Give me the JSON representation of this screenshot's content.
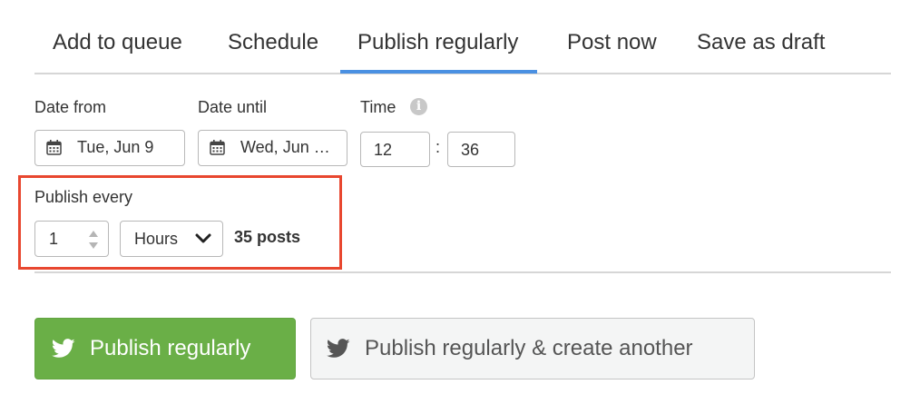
{
  "tabs": [
    {
      "label": "Add to queue"
    },
    {
      "label": "Schedule"
    },
    {
      "label": "Publish regularly",
      "active": true
    },
    {
      "label": "Post now"
    },
    {
      "label": "Save as draft"
    }
  ],
  "form": {
    "date_from": {
      "label": "Date from",
      "value": "Tue, Jun 9"
    },
    "date_until": {
      "label": "Date until",
      "value": "Wed, Jun …"
    },
    "time": {
      "label": "Time",
      "hour": "12",
      "separator": ":",
      "minute": "36"
    },
    "publish_every": {
      "label": "Publish every",
      "amount": "1",
      "unit": "Hours",
      "posts_count": "35 posts"
    }
  },
  "buttons": {
    "primary": "Publish regularly",
    "secondary": "Publish regularly & create another"
  },
  "colors": {
    "accent": "#4a90e2",
    "primary_button": "#6aaf47",
    "highlight": "#e8472f"
  }
}
